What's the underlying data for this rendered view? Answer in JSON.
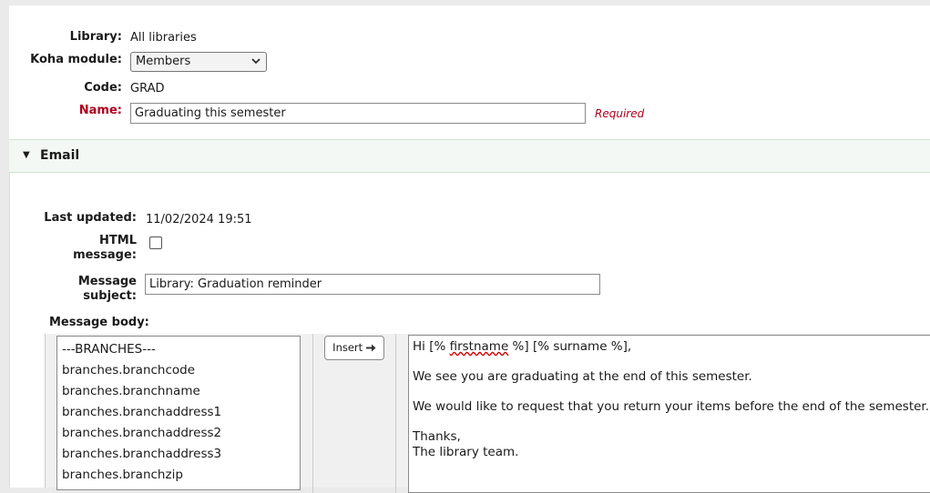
{
  "form": {
    "library_label": "Library:",
    "library_value": "All libraries",
    "module_label": "Koha module:",
    "module_value": "Members",
    "code_label": "Code:",
    "code_value": "GRAD",
    "name_label": "Name:",
    "name_value": "Graduating this semester",
    "required_text": "Required"
  },
  "email": {
    "section_title": "Email",
    "last_updated_label": "Last updated:",
    "last_updated_value": "11/02/2024 19:51",
    "html_label_1": "HTML",
    "html_label_2": "message:",
    "html_checked": false,
    "subject_label_1": "Message",
    "subject_label_2": "subject:",
    "subject_value": "Library: Graduation reminder",
    "body_label": "Message body:",
    "insert_label": "Insert",
    "fields": [
      "---BRANCHES---",
      "branches.branchcode",
      "branches.branchname",
      "branches.branchaddress1",
      "branches.branchaddress2",
      "branches.branchaddress3",
      "branches.branchzip"
    ],
    "body": {
      "line1_pre": "Hi [% ",
      "line1_spell": "firstname",
      "line1_post": " %] [% surname %],",
      "line2": "We see you are graduating at the end of this semester.",
      "line3": "We would like to request that you return your items before the end of the semester.",
      "line4a": "Thanks,",
      "line4b": "The library team."
    }
  },
  "colors": {
    "required": "#b0001e",
    "section_bg": "#f4f8f5",
    "page_bg": "#eaeaea"
  }
}
